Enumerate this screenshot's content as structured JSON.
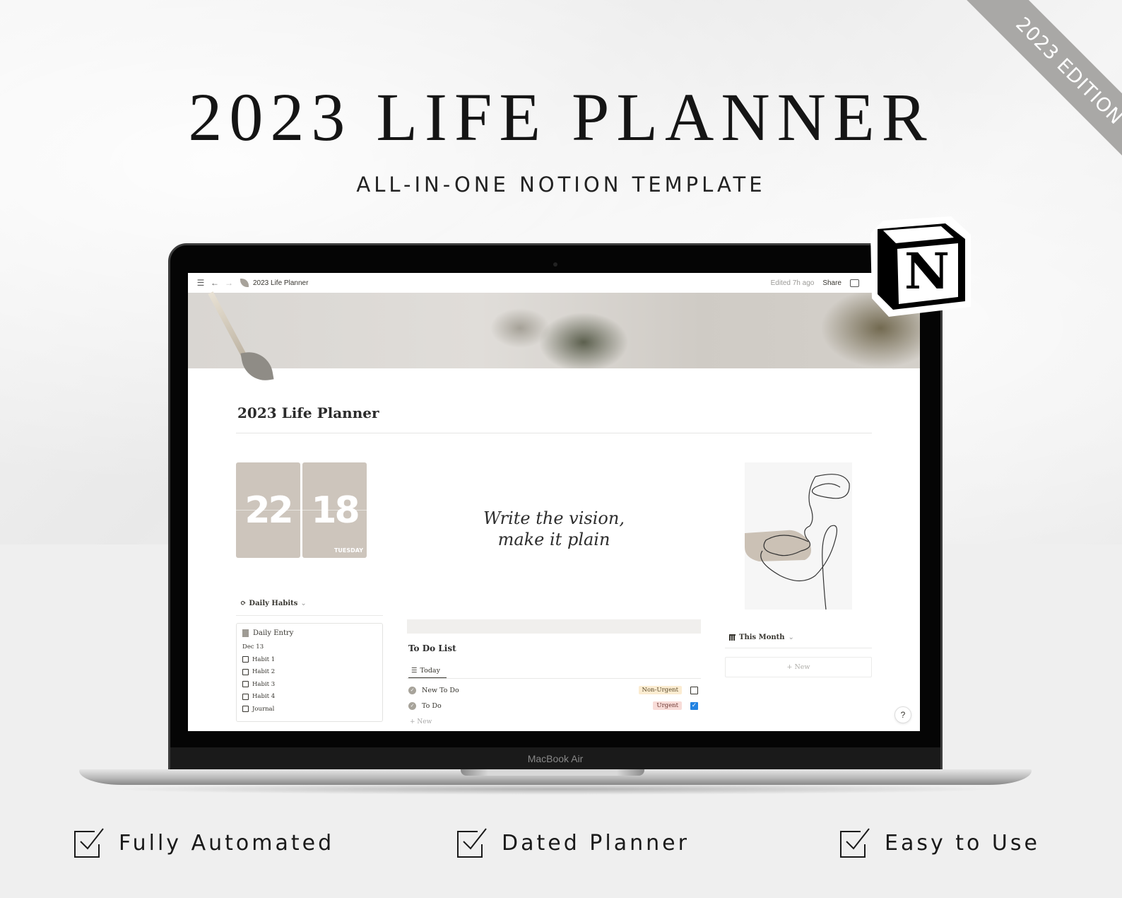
{
  "banner": {
    "headline": "2023 LIFE PLANNER",
    "subheadline": "ALL-IN-ONE NOTION TEMPLATE",
    "ribbon": "2023 EDITION",
    "brand_icon": "notion-logo-icon"
  },
  "device": {
    "label": "MacBook Air"
  },
  "notion": {
    "topbar": {
      "menu_icon": "hamburger-icon",
      "back_icon": "arrow-left-icon",
      "forward_icon": "arrow-right-icon",
      "page_icon": "leaf-icon",
      "breadcrumb": "2023 Life Planner",
      "edited": "Edited 7h ago",
      "share": "Share",
      "comment_icon": "comment-icon"
    },
    "page_title": "2023 Life Planner",
    "clock": {
      "hours": "22",
      "minutes": "18",
      "day": "TUESDAY",
      "color": "#cdc5bc"
    },
    "quote": {
      "line1": "Write the vision,",
      "line2": "make it plain"
    },
    "daily_habits": {
      "title": "Daily Habits",
      "card_title": "Daily Entry",
      "date": "Dec 13",
      "items": [
        {
          "label": "Habit 1",
          "checked": false
        },
        {
          "label": "Habit 2",
          "checked": false
        },
        {
          "label": "Habit 3",
          "checked": false
        },
        {
          "label": "Habit 4",
          "checked": false
        },
        {
          "label": "Journal",
          "checked": false
        }
      ]
    },
    "todo": {
      "title": "To Do List",
      "view_tab": "Today",
      "rows": [
        {
          "name": "New To Do",
          "tag": "Non-Urgent",
          "checked": false
        },
        {
          "name": "To Do",
          "tag": "Urgent",
          "checked": true
        }
      ],
      "new_label": "+ New"
    },
    "this_month": {
      "title": "This Month",
      "new_label": "+ New"
    },
    "help_label": "?",
    "colors": {
      "non_urgent_bg": "#fbecd1",
      "urgent_bg": "#f8dcd8",
      "checkbox_checked": "#2383e2"
    }
  },
  "features": [
    {
      "label": "Fully Automated",
      "icon": "checkbox-check-icon"
    },
    {
      "label": "Dated Planner",
      "icon": "checkbox-check-icon"
    },
    {
      "label": "Easy to Use",
      "icon": "checkbox-check-icon"
    }
  ]
}
